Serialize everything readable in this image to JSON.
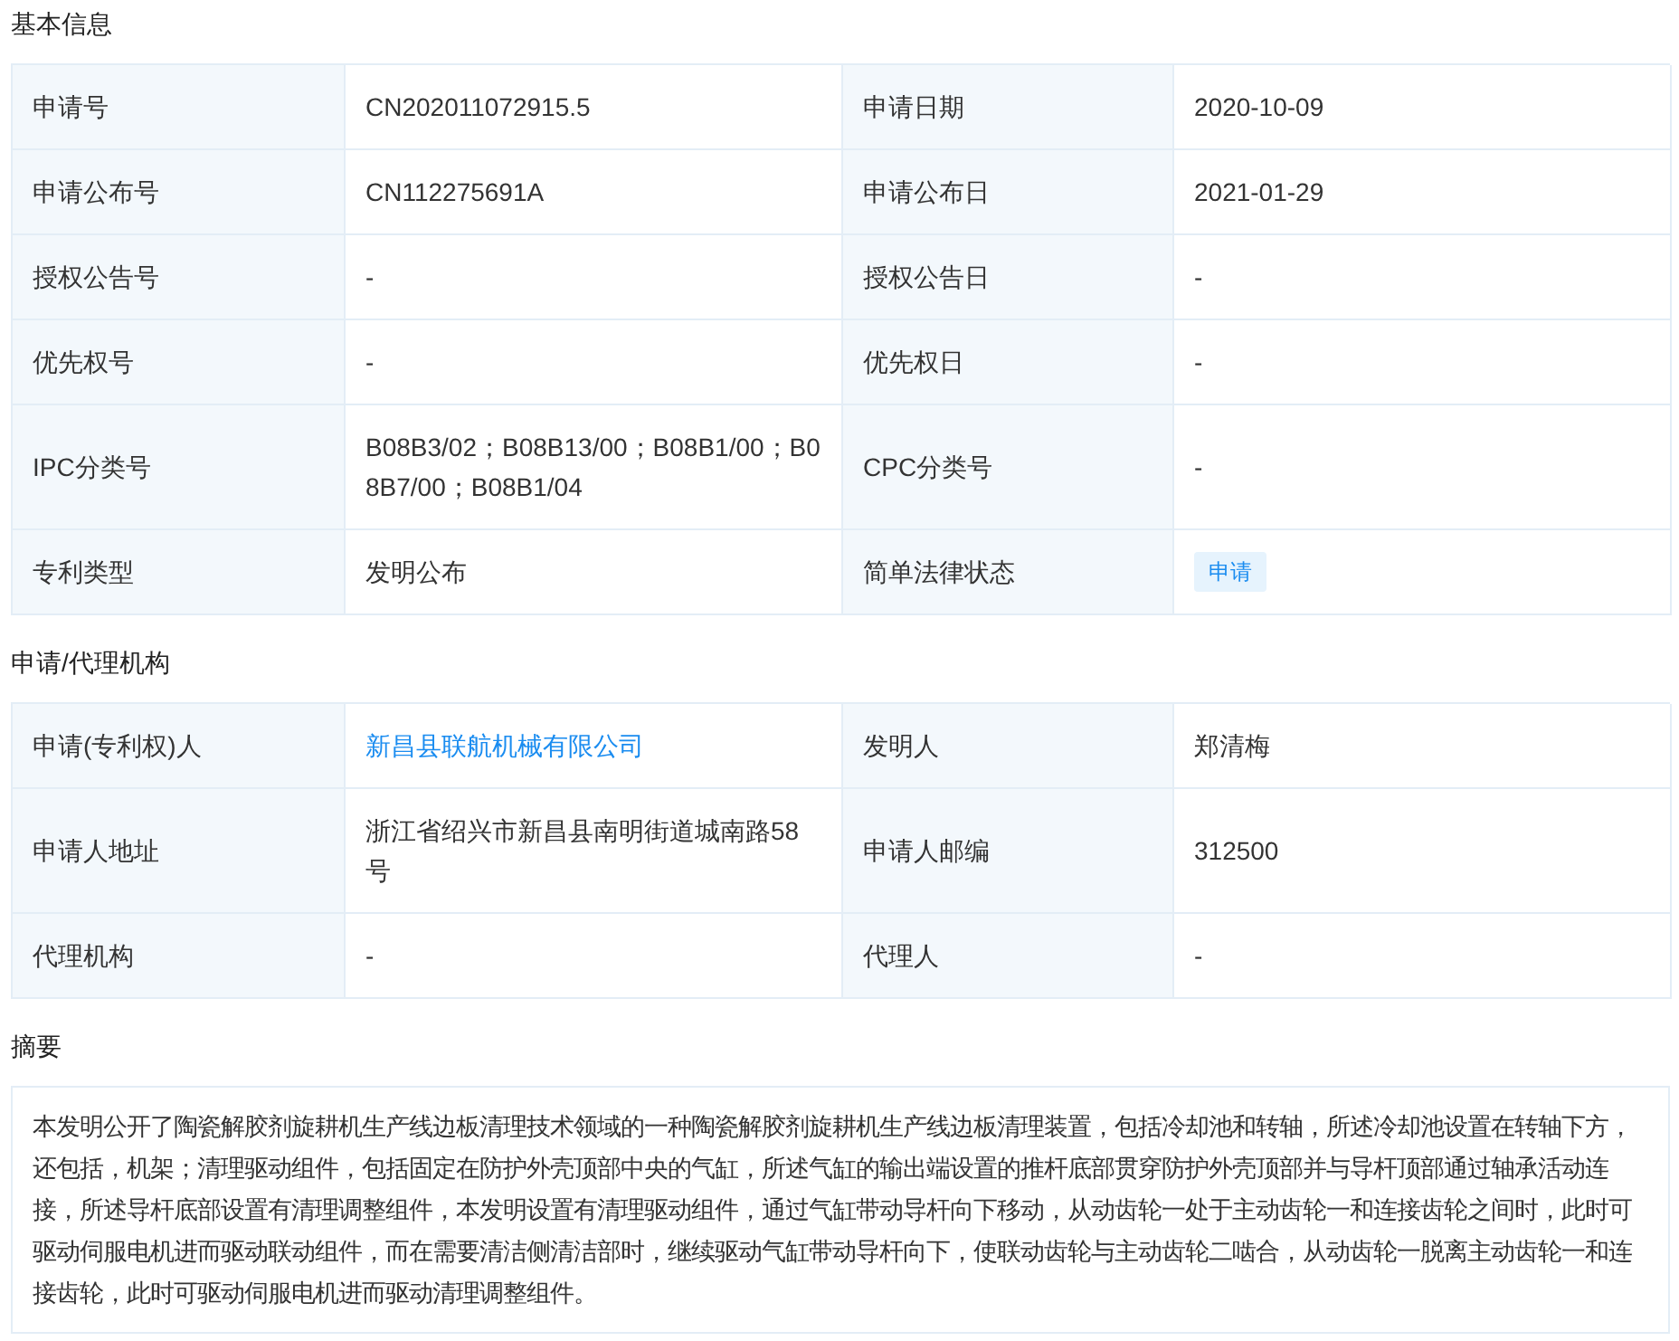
{
  "sections": [
    {
      "title": "基本信息",
      "rows": [
        [
          {
            "label": "申请号",
            "value": "CN202011072915.5",
            "kind": "text"
          },
          {
            "label": "申请日期",
            "value": "2020-10-09",
            "kind": "text"
          }
        ],
        [
          {
            "label": "申请公布号",
            "value": "CN112275691A",
            "kind": "text"
          },
          {
            "label": "申请公布日",
            "value": "2021-01-29",
            "kind": "text"
          }
        ],
        [
          {
            "label": "授权公告号",
            "value": "-",
            "kind": "text"
          },
          {
            "label": "授权公告日",
            "value": "-",
            "kind": "text"
          }
        ],
        [
          {
            "label": "优先权号",
            "value": "-",
            "kind": "text"
          },
          {
            "label": "优先权日",
            "value": "-",
            "kind": "text"
          }
        ],
        [
          {
            "label": "IPC分类号",
            "value": "B08B3/02；B08B13/00；B08B1/00；B08B7/00；B08B1/04",
            "kind": "text"
          },
          {
            "label": "CPC分类号",
            "value": "-",
            "kind": "text"
          }
        ],
        [
          {
            "label": "专利类型",
            "value": "发明公布",
            "kind": "text"
          },
          {
            "label": "简单法律状态",
            "value": "申请",
            "kind": "tag"
          }
        ]
      ]
    },
    {
      "title": "申请/代理机构",
      "rows": [
        [
          {
            "label": "申请(专利权)人",
            "value": "新昌县联航机械有限公司",
            "kind": "link"
          },
          {
            "label": "发明人",
            "value": "郑清梅",
            "kind": "text"
          }
        ],
        [
          {
            "label": "申请人地址",
            "value": "浙江省绍兴市新昌县南明街道城南路58号",
            "kind": "text"
          },
          {
            "label": "申请人邮编",
            "value": "312500",
            "kind": "text"
          }
        ],
        [
          {
            "label": "代理机构",
            "value": "-",
            "kind": "text"
          },
          {
            "label": "代理人",
            "value": "-",
            "kind": "text"
          }
        ]
      ]
    }
  ],
  "abstract": {
    "title": "摘要",
    "text": "本发明公开了陶瓷解胶剂旋耕机生产线边板清理技术领域的一种陶瓷解胶剂旋耕机生产线边板清理装置，包括冷却池和转轴，所述冷却池设置在转轴下方，还包括，机架；清理驱动组件，包括固定在防护外壳顶部中央的气缸，所述气缸的输出端设置的推杆底部贯穿防护外壳顶部并与导杆顶部通过轴承活动连接，所述导杆底部设置有清理调整组件，本发明设置有清理驱动组件，通过气缸带动导杆向下移动，从动齿轮一处于主动齿轮一和连接齿轮之间时，此时可驱动伺服电机进而驱动联动组件，而在需要清洁侧清洁部时，继续驱动气缸带动导杆向下，使联动齿轮与主动齿轮二啮合，从动齿轮一脱离主动齿轮一和连接齿轮，此时可驱动伺服电机进而驱动清理调整组件。"
  }
}
